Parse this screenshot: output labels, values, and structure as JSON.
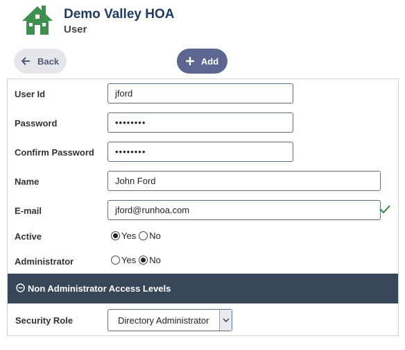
{
  "header": {
    "org_name": "Demo Valley HOA",
    "page_title": "User",
    "logo_color": "#3f8f4f"
  },
  "toolbar": {
    "back_label": "Back",
    "add_label": "Add"
  },
  "form": {
    "user_id": {
      "label": "User Id",
      "value": "jford"
    },
    "password": {
      "label": "Password",
      "value": "••••••••"
    },
    "confirm_password": {
      "label": "Confirm Password",
      "value": "••••••••"
    },
    "name": {
      "label": "Name",
      "value": "John Ford"
    },
    "email": {
      "label": "E-mail",
      "value": "jford@runhoa.com",
      "valid_icon": "check-icon"
    },
    "active": {
      "label": "Active",
      "yes": "Yes",
      "no": "No",
      "selected": "Yes"
    },
    "administrator": {
      "label": "Administrator",
      "yes": "Yes",
      "no": "No",
      "selected": "No"
    }
  },
  "section": {
    "title": "Non Administrator Access Levels",
    "icon": "minus-circle-icon"
  },
  "security_role": {
    "label": "Security Role",
    "selected": "Directory Administrator"
  },
  "colors": {
    "brand": "#1f3b63",
    "add_button": "#5d6690",
    "section_bar": "#36475a",
    "valid_check": "#2e8b3e"
  }
}
